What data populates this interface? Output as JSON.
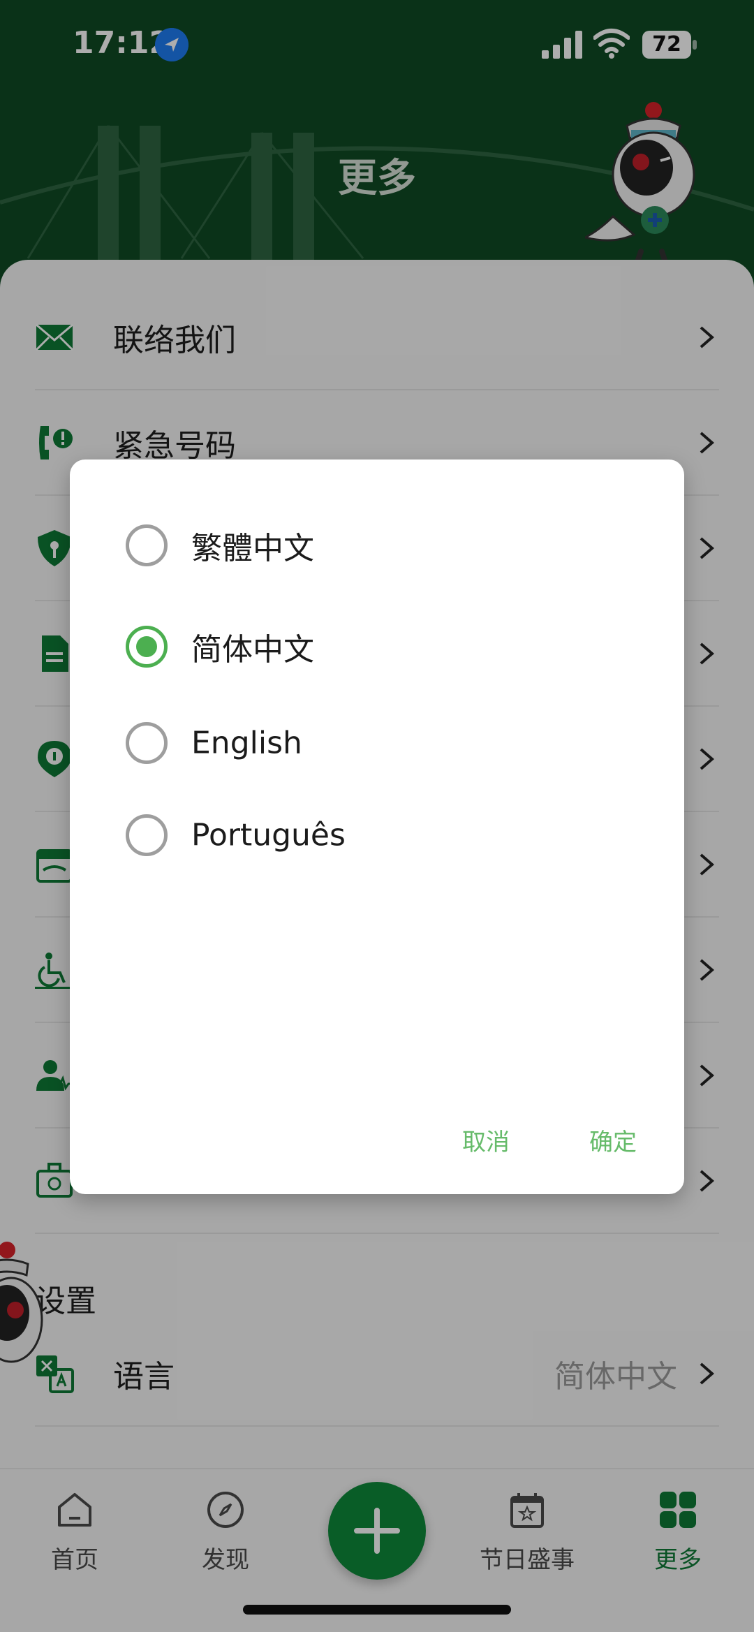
{
  "status_bar": {
    "time": "17:12",
    "battery": "72"
  },
  "header": {
    "title": "更多"
  },
  "menu": {
    "items": [
      {
        "label": "联络我们",
        "icon": "mail-icon"
      },
      {
        "label": "紧急号码",
        "icon": "phone-alert-icon"
      },
      {
        "label": "",
        "icon": "shield-info-icon"
      },
      {
        "label": "",
        "icon": "document-icon"
      },
      {
        "label": "",
        "icon": "location-info-icon"
      },
      {
        "label": "",
        "icon": "calendar-handshake-icon"
      },
      {
        "label": "",
        "icon": "wheelchair-icon"
      },
      {
        "label": "",
        "icon": "user-health-icon"
      },
      {
        "label": "",
        "icon": "briefcase-check-icon"
      }
    ]
  },
  "settings": {
    "title": "设置",
    "language_label": "语言",
    "language_value": "简体中文"
  },
  "dialog": {
    "options": [
      {
        "label": "繁體中文",
        "selected": false
      },
      {
        "label": "简体中文",
        "selected": true
      },
      {
        "label": "English",
        "selected": false
      },
      {
        "label": "Português",
        "selected": false
      }
    ],
    "cancel": "取消",
    "confirm": "确定"
  },
  "tabbar": {
    "tabs": [
      {
        "label": "首页"
      },
      {
        "label": "发现"
      },
      {
        "label": "节日盛事"
      },
      {
        "label": "更多"
      }
    ]
  },
  "colors": {
    "brand_green": "#0e8a3a",
    "header_green": "#0f4a24",
    "accent_light_green": "#4caf50"
  }
}
